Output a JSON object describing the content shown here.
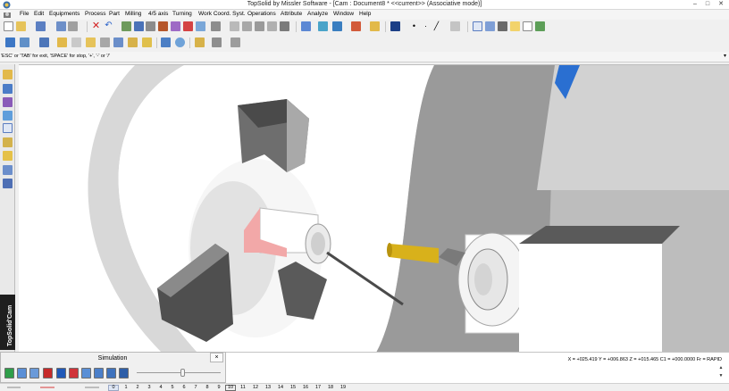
{
  "window": {
    "title": "TopSolid by Missler Software - [Cam : Document8 *  <<current>> (Associative mode)]",
    "minimize": "–",
    "maximize": "□",
    "close": "✕",
    "mdi_minimize": "–",
    "mdi_restore": "▫",
    "mdi_close": "✕"
  },
  "menu": {
    "items": [
      "File",
      "Edit",
      "Equipments",
      "Process",
      "Part",
      "Milling",
      "4/5 axis",
      "Turning",
      "Work Coord. Syst.",
      "Operations",
      "Attribute",
      "Analyze",
      "Window",
      "Help"
    ]
  },
  "prompt": {
    "text": "'ESC' or 'TAB' for exit, 'SPACE' for stop, '+', '-' or '/'"
  },
  "sidebar": {
    "brand": "TopSolid'Cam"
  },
  "simulation": {
    "title": "Simulation",
    "close": "×"
  },
  "status": {
    "coordinates": "X = +025.419  Y = +006.863  Z = +015.465  C1 = +000.0000  Fr = RAPID"
  },
  "scroll": {
    "up": "▲",
    "down": "▼"
  },
  "layers": {
    "numbers": [
      "0",
      "1",
      "2",
      "3",
      "4",
      "5",
      "6",
      "7",
      "8",
      "9",
      "10",
      "11",
      "12",
      "13",
      "14",
      "15",
      "16",
      "17",
      "18",
      "19"
    ],
    "active": "0",
    "current": "10"
  },
  "colors": {
    "active_tool": "#2a6fd1",
    "part_highlight": "#f2a8a8",
    "tool_gold": "#d8b11b",
    "viewport_bg": "#ffffff"
  }
}
